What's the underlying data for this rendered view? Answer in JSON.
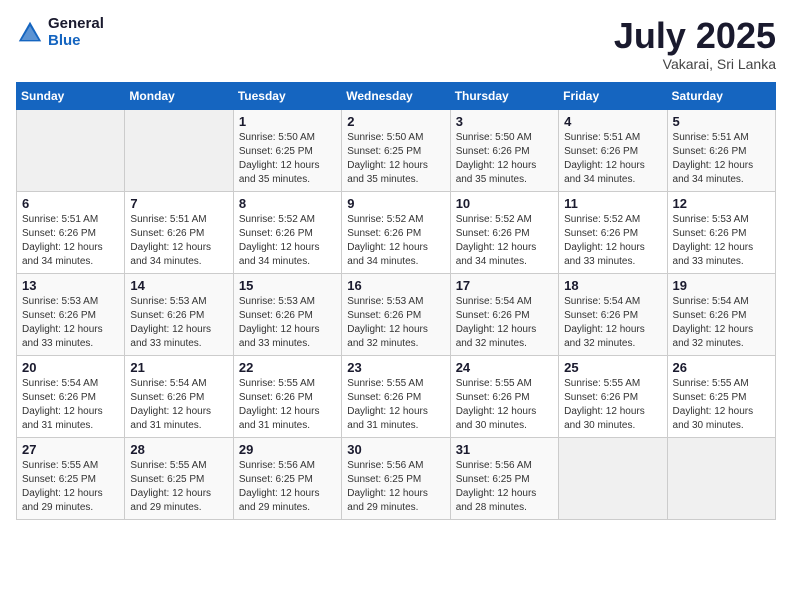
{
  "logo": {
    "general": "General",
    "blue": "Blue"
  },
  "header": {
    "month": "July 2025",
    "location": "Vakarai, Sri Lanka"
  },
  "weekdays": [
    "Sunday",
    "Monday",
    "Tuesday",
    "Wednesday",
    "Thursday",
    "Friday",
    "Saturday"
  ],
  "weeks": [
    [
      {
        "day": "",
        "empty": true
      },
      {
        "day": "",
        "empty": true
      },
      {
        "day": "1",
        "sunrise": "Sunrise: 5:50 AM",
        "sunset": "Sunset: 6:25 PM",
        "daylight": "Daylight: 12 hours and 35 minutes."
      },
      {
        "day": "2",
        "sunrise": "Sunrise: 5:50 AM",
        "sunset": "Sunset: 6:25 PM",
        "daylight": "Daylight: 12 hours and 35 minutes."
      },
      {
        "day": "3",
        "sunrise": "Sunrise: 5:50 AM",
        "sunset": "Sunset: 6:26 PM",
        "daylight": "Daylight: 12 hours and 35 minutes."
      },
      {
        "day": "4",
        "sunrise": "Sunrise: 5:51 AM",
        "sunset": "Sunset: 6:26 PM",
        "daylight": "Daylight: 12 hours and 34 minutes."
      },
      {
        "day": "5",
        "sunrise": "Sunrise: 5:51 AM",
        "sunset": "Sunset: 6:26 PM",
        "daylight": "Daylight: 12 hours and 34 minutes."
      }
    ],
    [
      {
        "day": "6",
        "sunrise": "Sunrise: 5:51 AM",
        "sunset": "Sunset: 6:26 PM",
        "daylight": "Daylight: 12 hours and 34 minutes."
      },
      {
        "day": "7",
        "sunrise": "Sunrise: 5:51 AM",
        "sunset": "Sunset: 6:26 PM",
        "daylight": "Daylight: 12 hours and 34 minutes."
      },
      {
        "day": "8",
        "sunrise": "Sunrise: 5:52 AM",
        "sunset": "Sunset: 6:26 PM",
        "daylight": "Daylight: 12 hours and 34 minutes."
      },
      {
        "day": "9",
        "sunrise": "Sunrise: 5:52 AM",
        "sunset": "Sunset: 6:26 PM",
        "daylight": "Daylight: 12 hours and 34 minutes."
      },
      {
        "day": "10",
        "sunrise": "Sunrise: 5:52 AM",
        "sunset": "Sunset: 6:26 PM",
        "daylight": "Daylight: 12 hours and 34 minutes."
      },
      {
        "day": "11",
        "sunrise": "Sunrise: 5:52 AM",
        "sunset": "Sunset: 6:26 PM",
        "daylight": "Daylight: 12 hours and 33 minutes."
      },
      {
        "day": "12",
        "sunrise": "Sunrise: 5:53 AM",
        "sunset": "Sunset: 6:26 PM",
        "daylight": "Daylight: 12 hours and 33 minutes."
      }
    ],
    [
      {
        "day": "13",
        "sunrise": "Sunrise: 5:53 AM",
        "sunset": "Sunset: 6:26 PM",
        "daylight": "Daylight: 12 hours and 33 minutes."
      },
      {
        "day": "14",
        "sunrise": "Sunrise: 5:53 AM",
        "sunset": "Sunset: 6:26 PM",
        "daylight": "Daylight: 12 hours and 33 minutes."
      },
      {
        "day": "15",
        "sunrise": "Sunrise: 5:53 AM",
        "sunset": "Sunset: 6:26 PM",
        "daylight": "Daylight: 12 hours and 33 minutes."
      },
      {
        "day": "16",
        "sunrise": "Sunrise: 5:53 AM",
        "sunset": "Sunset: 6:26 PM",
        "daylight": "Daylight: 12 hours and 32 minutes."
      },
      {
        "day": "17",
        "sunrise": "Sunrise: 5:54 AM",
        "sunset": "Sunset: 6:26 PM",
        "daylight": "Daylight: 12 hours and 32 minutes."
      },
      {
        "day": "18",
        "sunrise": "Sunrise: 5:54 AM",
        "sunset": "Sunset: 6:26 PM",
        "daylight": "Daylight: 12 hours and 32 minutes."
      },
      {
        "day": "19",
        "sunrise": "Sunrise: 5:54 AM",
        "sunset": "Sunset: 6:26 PM",
        "daylight": "Daylight: 12 hours and 32 minutes."
      }
    ],
    [
      {
        "day": "20",
        "sunrise": "Sunrise: 5:54 AM",
        "sunset": "Sunset: 6:26 PM",
        "daylight": "Daylight: 12 hours and 31 minutes."
      },
      {
        "day": "21",
        "sunrise": "Sunrise: 5:54 AM",
        "sunset": "Sunset: 6:26 PM",
        "daylight": "Daylight: 12 hours and 31 minutes."
      },
      {
        "day": "22",
        "sunrise": "Sunrise: 5:55 AM",
        "sunset": "Sunset: 6:26 PM",
        "daylight": "Daylight: 12 hours and 31 minutes."
      },
      {
        "day": "23",
        "sunrise": "Sunrise: 5:55 AM",
        "sunset": "Sunset: 6:26 PM",
        "daylight": "Daylight: 12 hours and 31 minutes."
      },
      {
        "day": "24",
        "sunrise": "Sunrise: 5:55 AM",
        "sunset": "Sunset: 6:26 PM",
        "daylight": "Daylight: 12 hours and 30 minutes."
      },
      {
        "day": "25",
        "sunrise": "Sunrise: 5:55 AM",
        "sunset": "Sunset: 6:26 PM",
        "daylight": "Daylight: 12 hours and 30 minutes."
      },
      {
        "day": "26",
        "sunrise": "Sunrise: 5:55 AM",
        "sunset": "Sunset: 6:25 PM",
        "daylight": "Daylight: 12 hours and 30 minutes."
      }
    ],
    [
      {
        "day": "27",
        "sunrise": "Sunrise: 5:55 AM",
        "sunset": "Sunset: 6:25 PM",
        "daylight": "Daylight: 12 hours and 29 minutes."
      },
      {
        "day": "28",
        "sunrise": "Sunrise: 5:55 AM",
        "sunset": "Sunset: 6:25 PM",
        "daylight": "Daylight: 12 hours and 29 minutes."
      },
      {
        "day": "29",
        "sunrise": "Sunrise: 5:56 AM",
        "sunset": "Sunset: 6:25 PM",
        "daylight": "Daylight: 12 hours and 29 minutes."
      },
      {
        "day": "30",
        "sunrise": "Sunrise: 5:56 AM",
        "sunset": "Sunset: 6:25 PM",
        "daylight": "Daylight: 12 hours and 29 minutes."
      },
      {
        "day": "31",
        "sunrise": "Sunrise: 5:56 AM",
        "sunset": "Sunset: 6:25 PM",
        "daylight": "Daylight: 12 hours and 28 minutes."
      },
      {
        "day": "",
        "empty": true
      },
      {
        "day": "",
        "empty": true
      }
    ]
  ]
}
